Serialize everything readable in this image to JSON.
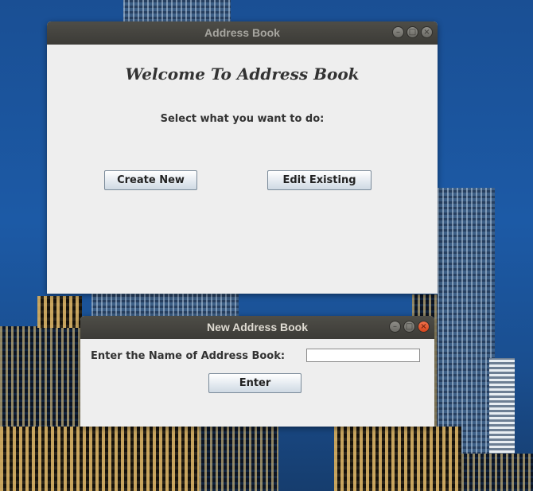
{
  "main_window": {
    "title": "Address Book",
    "heading": "Welcome To Address Book",
    "prompt": "Select what you want to do:",
    "create_button": "Create New",
    "edit_button": "Edit Existing",
    "controls": {
      "minimize": "–",
      "maximize": "□",
      "close": "×"
    },
    "title_color": "#a7a6a0"
  },
  "dialog_window": {
    "title": "New Address Book",
    "field_label": "Enter the Name of Address Book:",
    "field_value": "",
    "enter_button": "Enter",
    "controls": {
      "minimize": "–",
      "maximize": "□",
      "close": "×"
    },
    "title_color": "#dfdbd2",
    "close_color": "#e5582d"
  },
  "desktop": {
    "background_color": "#1c5aa6"
  }
}
